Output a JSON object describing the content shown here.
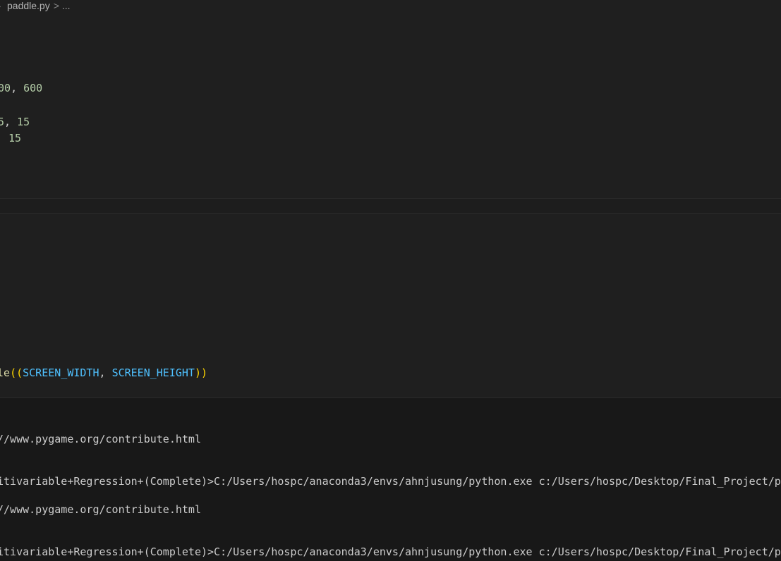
{
  "breadcrumb": {
    "file": "paddle.py",
    "separator": ">",
    "more": "..."
  },
  "editor": {
    "lines": [
      {
        "parts": [
          "00",
          ", ",
          "600"
        ]
      },
      {
        "parts": [
          "5",
          ", ",
          "15"
        ]
      },
      {
        "parts": [
          "15"
        ]
      },
      {
        "parts": [
          "le",
          "((",
          "SCREEN_WIDTH",
          ", ",
          "SCREEN_HEIGHT",
          "))"
        ]
      }
    ]
  },
  "terminal": {
    "lines": [
      "//www.pygame.org/contribute.html",
      "itivariable+Regression+(Complete)>C:/Users/hospc/anaconda3/envs/ahnjusung/python.exe c:/Users/hospc/Desktop/Final_Project/pa",
      ")",
      "//www.pygame.org/contribute.html",
      "itivariable+Regression+(Complete)>C:/Users/hospc/anaconda3/envs/ahnjusung/python.exe c:/Users/hospc/Desktop/Final_Project/pa"
    ]
  },
  "colors": {
    "editor_bg": "#1f1f1f",
    "terminal_bg": "#181818",
    "number": "#b5cea8",
    "constant": "#4fc1ff",
    "function": "#dcdcaa",
    "bracket": "#ffd700"
  }
}
